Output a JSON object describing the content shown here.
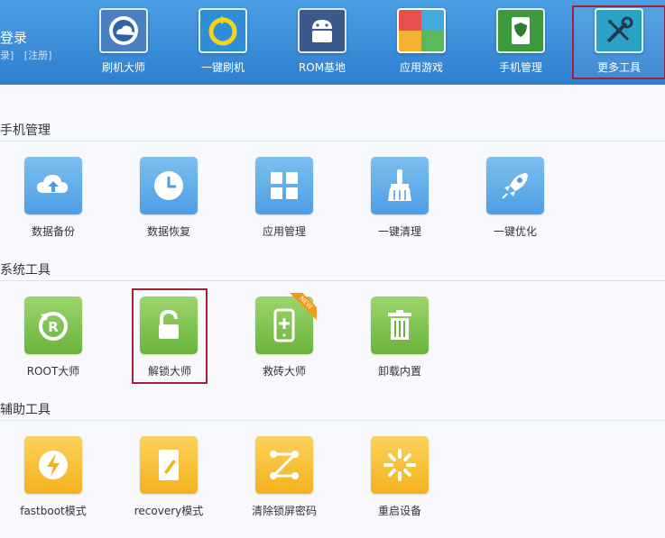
{
  "header": {
    "login_title": "登录",
    "login_link": "录]",
    "register_link": "[注册]",
    "nav": [
      {
        "label": "刷机大师",
        "icon": "cloud-disc-icon",
        "color": "#4a7fc1"
      },
      {
        "label": "一键刷机",
        "icon": "refresh-icon",
        "color": "#2f8fd6"
      },
      {
        "label": "ROM基地",
        "icon": "android-icon",
        "color": "#3b5a8a"
      },
      {
        "label": "应用游戏",
        "icon": "tiles-icon",
        "color": "#e85050"
      },
      {
        "label": "手机管理",
        "icon": "phone-shield-icon",
        "color": "#3c9a3c"
      },
      {
        "label": "更多工具",
        "icon": "tools-icon",
        "color": "#2aa2c8"
      }
    ]
  },
  "sections": {
    "phone_manage": {
      "title": "手机管理",
      "items": [
        {
          "label": "数据备份",
          "icon": "cloud-upload-icon"
        },
        {
          "label": "数据恢复",
          "icon": "clock-icon"
        },
        {
          "label": "应用管理",
          "icon": "grid-icon"
        },
        {
          "label": "一键清理",
          "icon": "broom-icon"
        },
        {
          "label": "一键优化",
          "icon": "rocket-icon"
        }
      ]
    },
    "system_tools": {
      "title": "系统工具",
      "items": [
        {
          "label": "ROOT大师",
          "icon": "root-icon"
        },
        {
          "label": "解锁大师",
          "icon": "unlock-icon"
        },
        {
          "label": "救砖大师",
          "icon": "phone-plus-icon",
          "badge": "NEW"
        },
        {
          "label": "卸载内置",
          "icon": "trash-icon"
        }
      ]
    },
    "aux_tools": {
      "title": "辅助工具",
      "items": [
        {
          "label": "fastboot模式",
          "icon": "lightning-icon"
        },
        {
          "label": "recovery模式",
          "icon": "tablet-pen-icon"
        },
        {
          "label": "清除锁屏密码",
          "icon": "pattern-icon"
        },
        {
          "label": "重启设备",
          "icon": "loading-icon"
        }
      ]
    }
  }
}
